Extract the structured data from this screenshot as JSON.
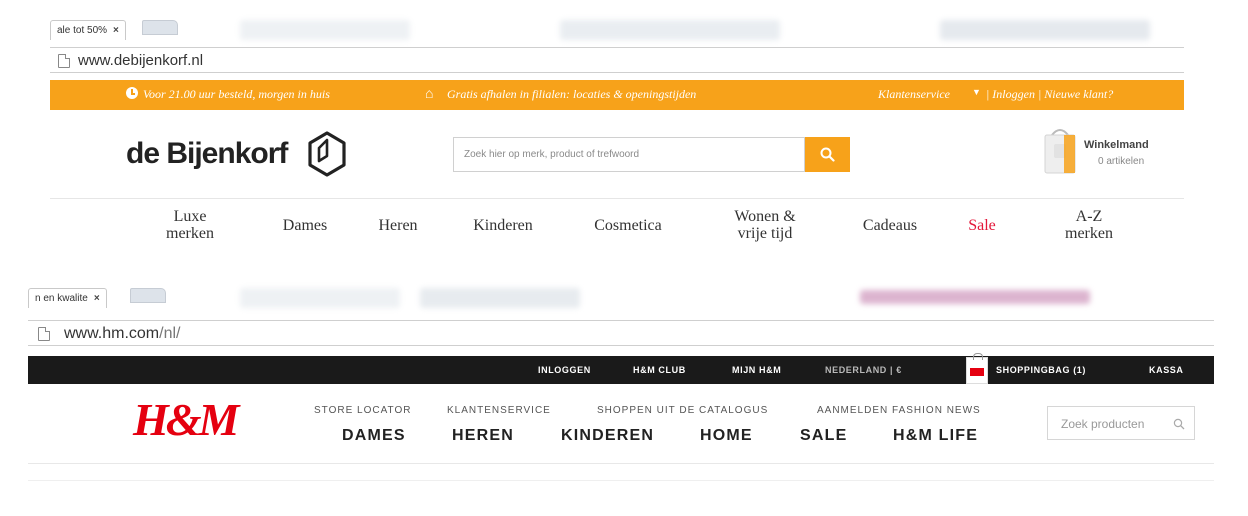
{
  "bijenkorf": {
    "browser": {
      "tab_title": "ale tot 50%",
      "tab_close": "×",
      "url": "www.debijenkorf.nl"
    },
    "topbar": {
      "delivery_text": "Voor 21.00 uur besteld, morgen in huis",
      "pickup_text": "Gratis afhalen in filialen: locaties & openingstijden",
      "service_text": "Klantenservice",
      "account_links": "| Inloggen | Nieuwe klant?",
      "brand_color": "#f7a21a",
      "icons": [
        "clock-icon",
        "home-icon",
        "caret-down-icon"
      ]
    },
    "header": {
      "logo_text": "de Bijenkorf",
      "search_placeholder": "Zoek hier op merk, product of trefwoord",
      "cart_title": "Winkelmand",
      "cart_count": "0 artikelen"
    },
    "nav": [
      {
        "line1": "Luxe",
        "line2": "merken"
      },
      {
        "line1": "Dames",
        "line2": ""
      },
      {
        "line1": "Heren",
        "line2": ""
      },
      {
        "line1": "Kinderen",
        "line2": ""
      },
      {
        "line1": "Cosmetica",
        "line2": ""
      },
      {
        "line1": "Wonen &",
        "line2": "vrije tijd"
      },
      {
        "line1": "Cadeaus",
        "line2": ""
      },
      {
        "line1": "Sale",
        "line2": ""
      },
      {
        "line1": "A-Z",
        "line2": "merken"
      }
    ],
    "sale_color": "#e3183a"
  },
  "hm": {
    "browser": {
      "tab_title": "n en kwalite",
      "tab_close": "×",
      "url_host": "www.hm.com",
      "url_path": "/nl/"
    },
    "topbar": {
      "login": "INLOGGEN",
      "club": "H&M CLUB",
      "my_hm": "MIJN H&M",
      "country": "NEDERLAND | €",
      "shoppingbag": "SHOPPINGBAG (1)",
      "checkout": "KASSA"
    },
    "logo_text": "H&M",
    "logo_color": "#e50010",
    "secondary_nav": [
      "STORE LOCATOR",
      "KLANTENSERVICE",
      "SHOPPEN UIT DE CATALOGUS",
      "AANMELDEN FASHION NEWS"
    ],
    "main_nav": [
      "DAMES",
      "HEREN",
      "KINDEREN",
      "HOME",
      "SALE",
      "H&M LIFE"
    ],
    "search_placeholder": "Zoek producten"
  }
}
